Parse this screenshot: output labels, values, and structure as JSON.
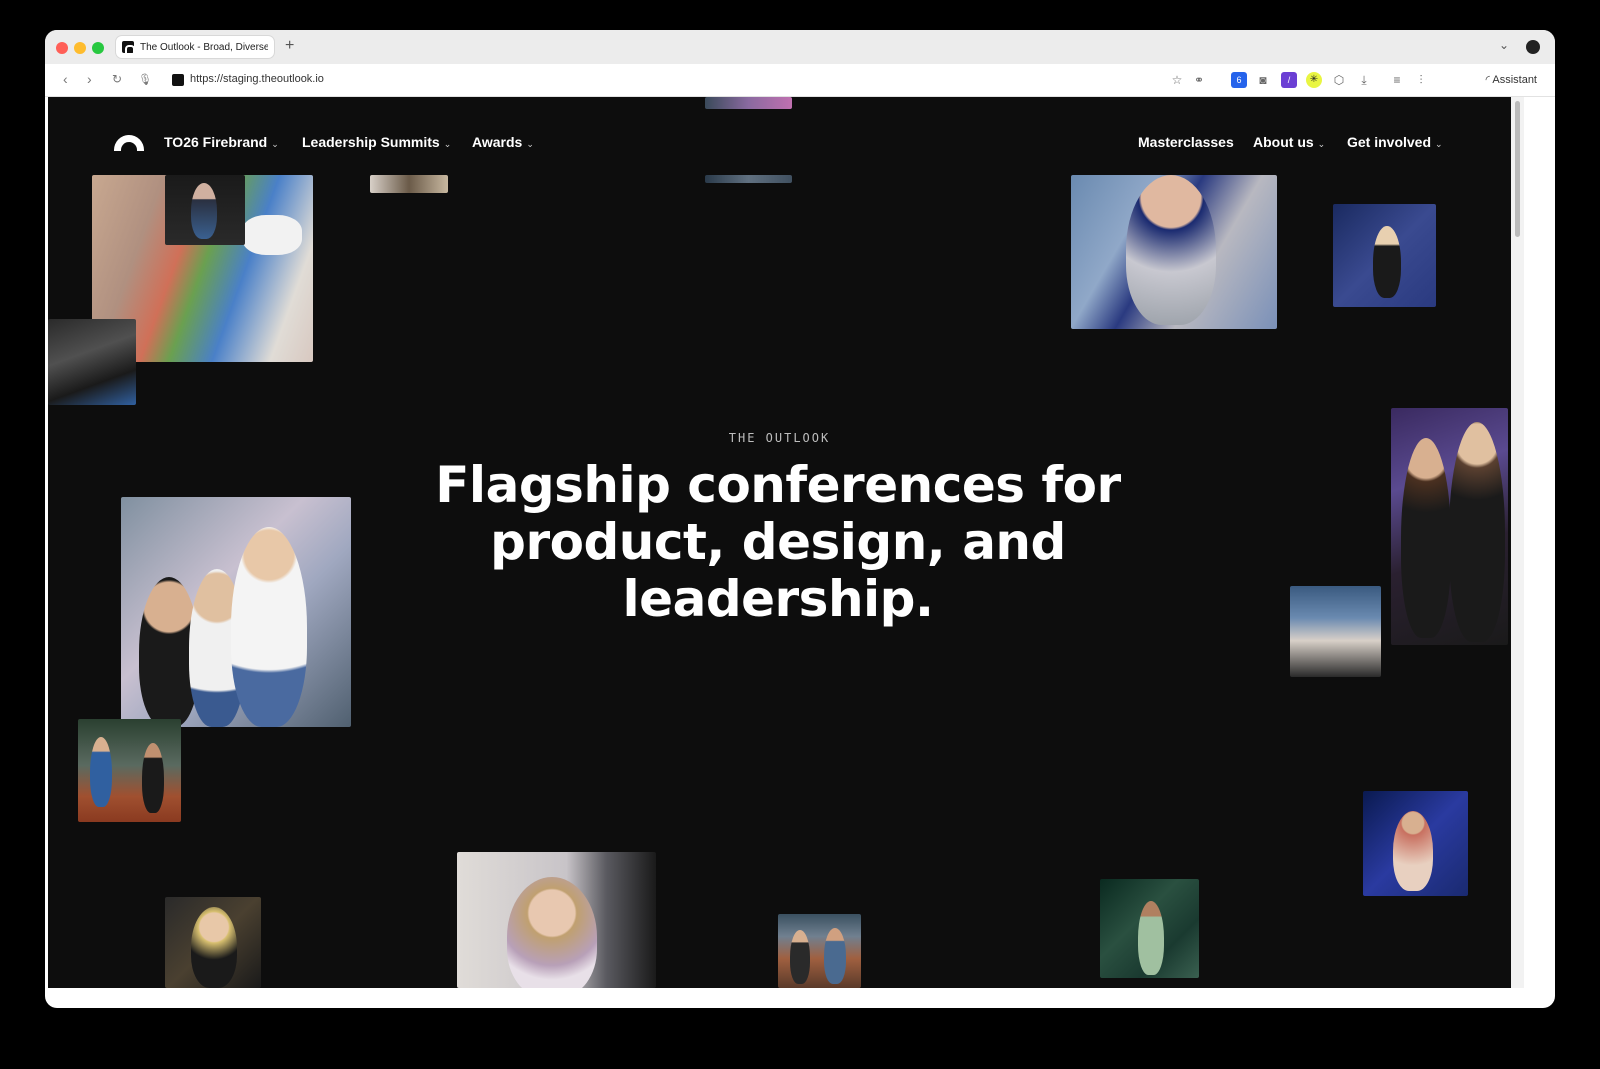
{
  "browser": {
    "tab_title": "The Outlook - Broad, Diverse",
    "new_tab": "+",
    "url": "https://staging.theoutlook.io",
    "assistant_label": "Assistant",
    "extension_badge": "6"
  },
  "site": {
    "nav": {
      "left": [
        {
          "label": "TO26 Firebrand",
          "has_dropdown": true
        },
        {
          "label": "Leadership Summits",
          "has_dropdown": true
        },
        {
          "label": "Awards",
          "has_dropdown": true
        }
      ],
      "right": [
        {
          "label": "Masterclasses",
          "has_dropdown": false
        },
        {
          "label": "About us",
          "has_dropdown": true
        },
        {
          "label": "Get involved",
          "has_dropdown": true
        }
      ]
    },
    "hero": {
      "kicker": "THE OUTLOOK",
      "title": "Flagship conferences for product, design, and leadership."
    }
  },
  "icons": {
    "back": "chevron-left-icon",
    "forward": "chevron-right-icon",
    "reload": "reload-icon",
    "mic": "microphone-icon",
    "star": "star-icon",
    "link": "link-icon",
    "camera": "camera-icon",
    "puzzle": "extensions-icon",
    "download": "download-icon",
    "menu": "reader-icon",
    "audio": "audio-icon"
  },
  "colors": {
    "page_bg": "#0d0d0d",
    "text": "#ffffff",
    "kicker": "#bdbdbd"
  }
}
